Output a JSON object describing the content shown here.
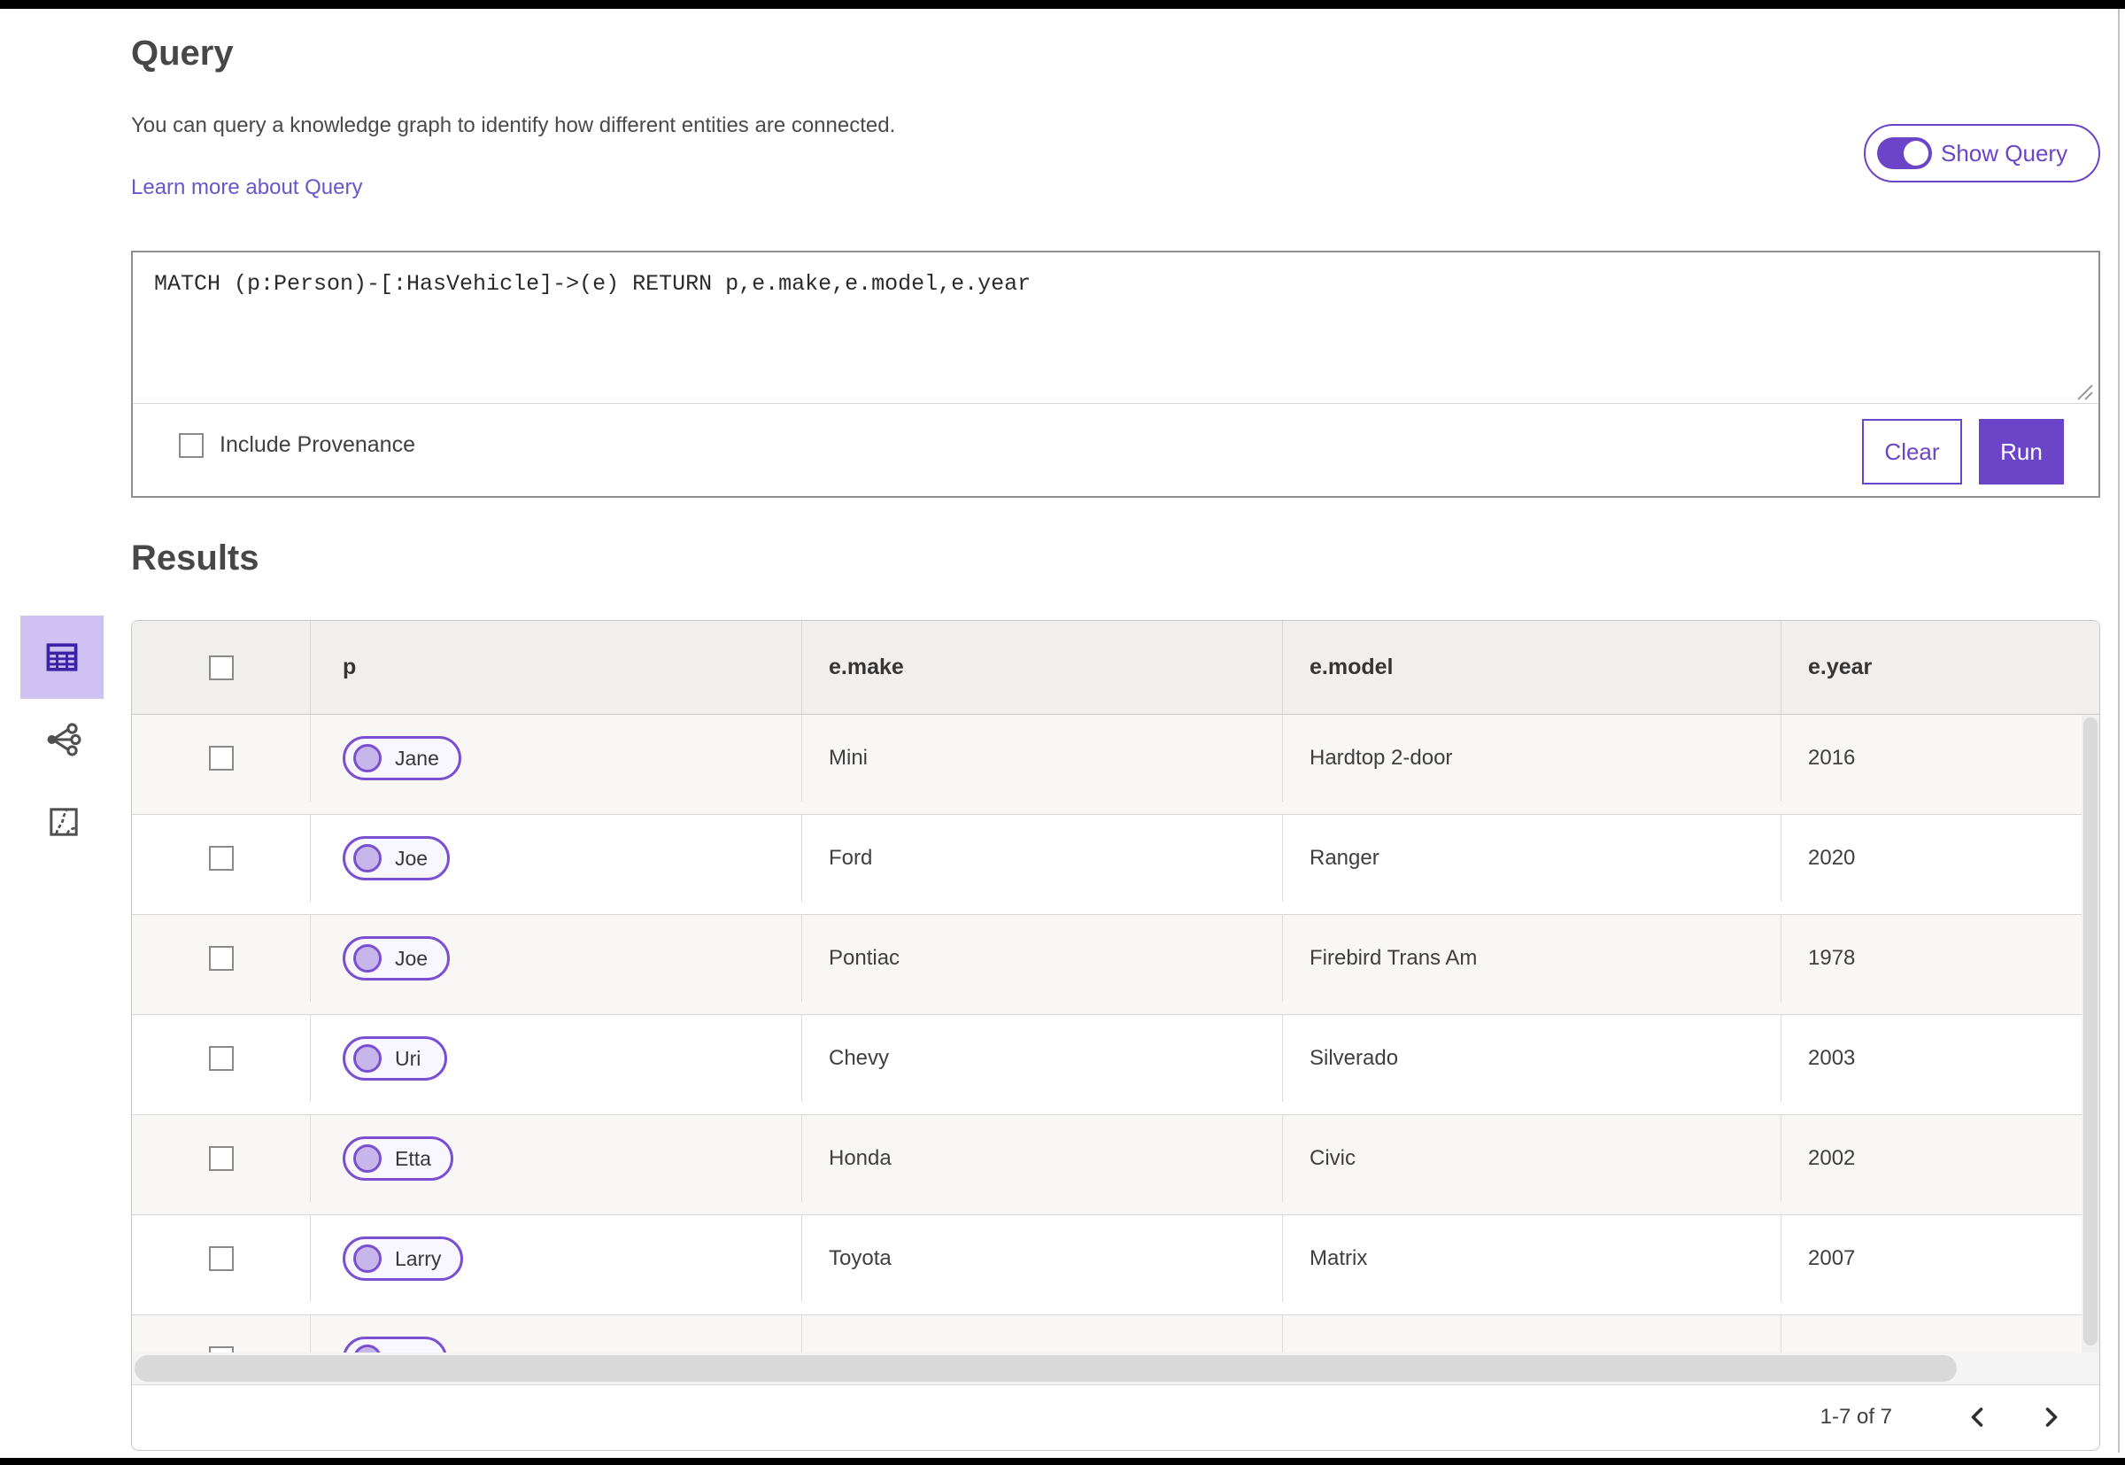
{
  "colors": {
    "accent_purple": "#6b44c8",
    "pill_border_purple": "#7a4fd2",
    "pill_circle_fill": "#c7b6ea",
    "selected_tile_bg": "#cfc1f2",
    "selected_tile_icon": "#3a23a8",
    "link_purple": "#6a55c8",
    "header_bg": "#f1efed",
    "alt_row_bg": "#f8f7f6"
  },
  "query_panel": {
    "title": "Query",
    "description": "You can query a knowledge graph to identify how different entities are connected.",
    "learn_more_link": "Learn more about Query",
    "show_query_label": "Show Query",
    "show_query_toggle_state": "on",
    "query_text": "MATCH (p:Person)-[:HasVehicle]->(e) RETURN p,e.make,e.model,e.year",
    "include_provenance_label": "Include Provenance",
    "include_provenance_checked": false,
    "clear_button": "Clear",
    "run_button": "Run"
  },
  "results_panel": {
    "title": "Results",
    "view_switcher": [
      {
        "icon": "table-view-icon",
        "selected": true
      },
      {
        "icon": "link-chart-view-icon",
        "selected": false
      },
      {
        "icon": "map-view-icon",
        "selected": false
      }
    ],
    "table": {
      "columns": [
        "p",
        "e.make",
        "e.model",
        "e.year"
      ],
      "rows": [
        {
          "p": "Jane",
          "e_make": "Mini",
          "e_model": "Hardtop 2-door",
          "e_year": "2016",
          "partial": false
        },
        {
          "p": "Joe",
          "e_make": "Ford",
          "e_model": "Ranger",
          "e_year": "2020",
          "partial": false
        },
        {
          "p": "Joe",
          "e_make": "Pontiac",
          "e_model": "Firebird Trans Am",
          "e_year": "1978",
          "partial": false
        },
        {
          "p": "Uri",
          "e_make": "Chevy",
          "e_model": "Silverado",
          "e_year": "2003",
          "partial": false
        },
        {
          "p": "Etta",
          "e_make": "Honda",
          "e_model": "Civic",
          "e_year": "2002",
          "partial": false
        },
        {
          "p": "Larry",
          "e_make": "Toyota",
          "e_model": "Matrix",
          "e_year": "2007",
          "partial": false
        },
        {
          "p": "",
          "e_make": "",
          "e_model": "",
          "e_year": "",
          "partial": true
        }
      ]
    },
    "pagination": {
      "range_label": "1-7 of 7",
      "prev_icon": "chevron-left-icon",
      "next_icon": "chevron-right-icon"
    }
  }
}
